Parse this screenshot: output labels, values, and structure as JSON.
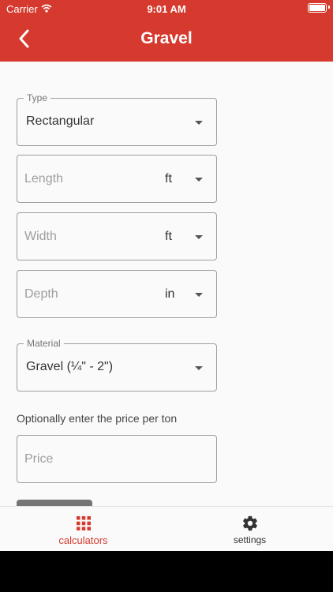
{
  "status": {
    "carrier": "Carrier",
    "time": "9:01 AM"
  },
  "header": {
    "title": "Gravel"
  },
  "form": {
    "type": {
      "legend": "Type",
      "value": "Rectangular"
    },
    "length": {
      "placeholder": "Length",
      "unit": "ft"
    },
    "width": {
      "placeholder": "Width",
      "unit": "ft"
    },
    "depth": {
      "placeholder": "Depth",
      "unit": "in"
    },
    "material": {
      "legend": "Material",
      "value": "Gravel (¼\" - 2\")"
    },
    "price_hint": "Optionally enter the price per ton",
    "price": {
      "placeholder": "Price"
    }
  },
  "bottom_nav": {
    "calculators": {
      "label": "calculators",
      "icon": "grid-icon"
    },
    "settings": {
      "label": "settings",
      "icon": "gear-icon"
    }
  },
  "colors": {
    "accent": "#d63a2e",
    "background": "#fafafa"
  }
}
